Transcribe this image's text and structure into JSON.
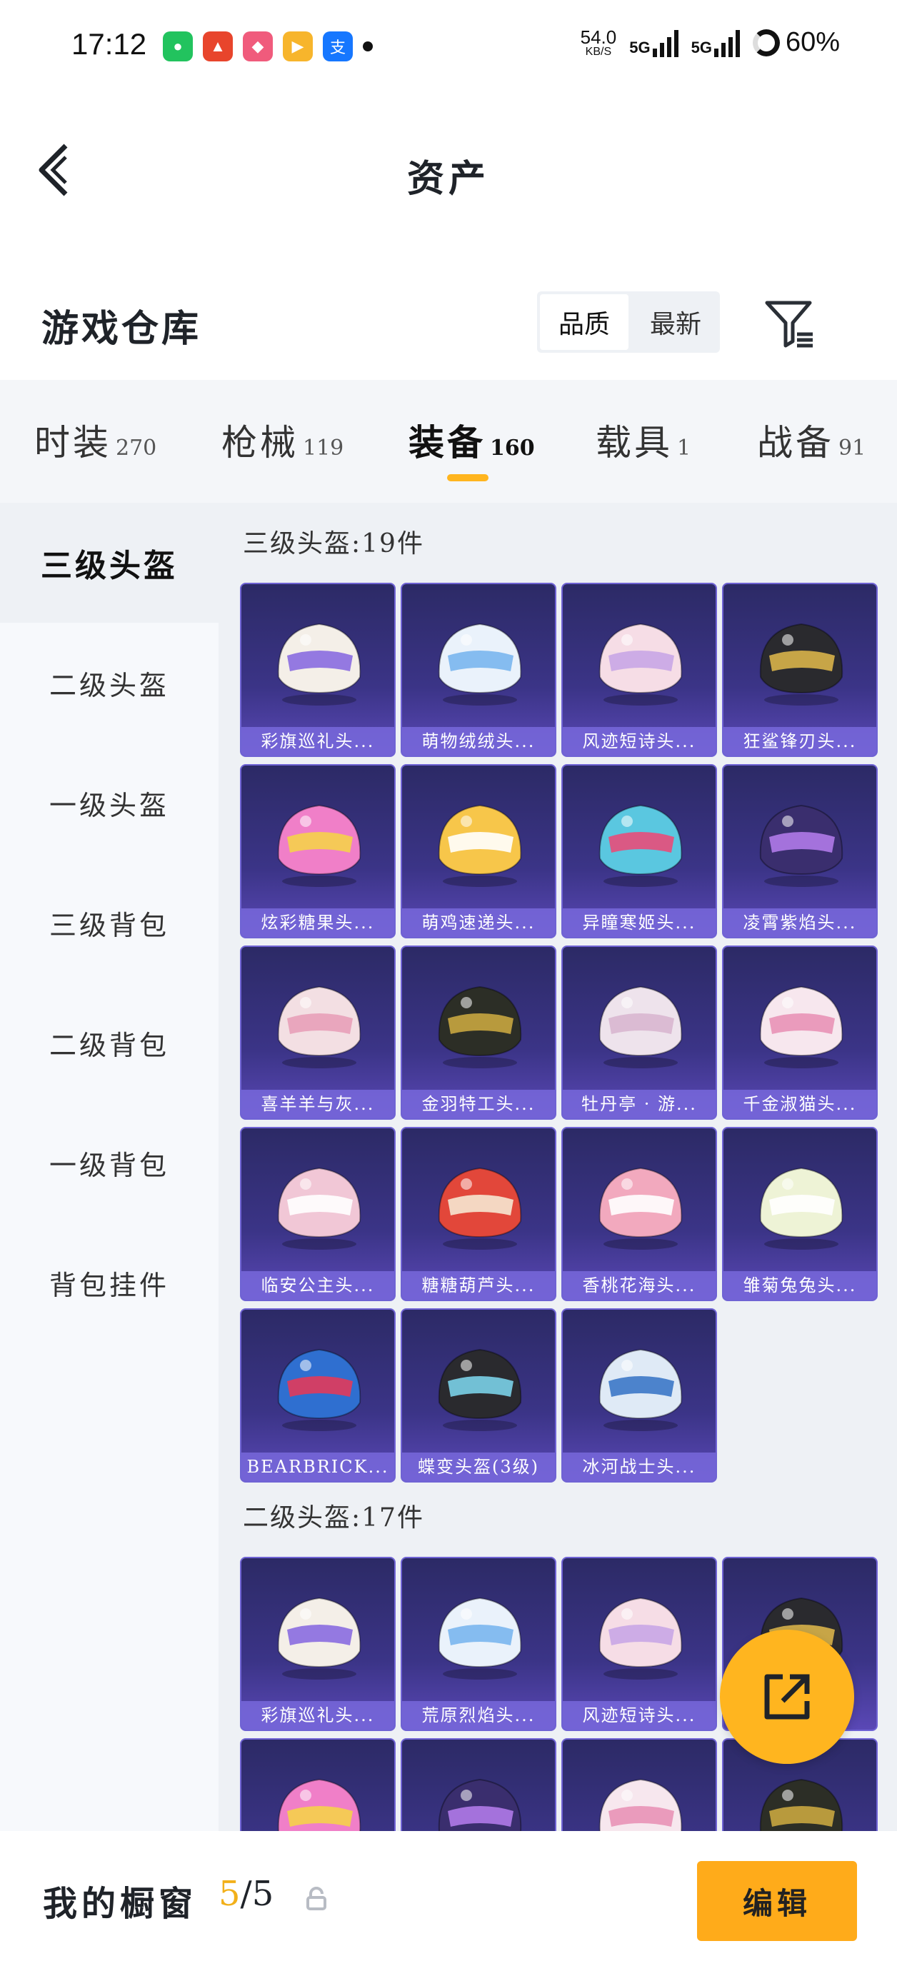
{
  "status_bar": {
    "time": "17:12",
    "speed_value": "54.0",
    "speed_unit": "KB/S",
    "signal1": "5G",
    "signal2": "5G",
    "battery": "60%"
  },
  "header": {
    "title": "资产"
  },
  "warehouse": {
    "label": "游戏仓库",
    "sort_options": [
      "品质",
      "最新"
    ],
    "sort_selected": "品质"
  },
  "tabs": [
    {
      "label": "时装",
      "count": "270"
    },
    {
      "label": "枪械",
      "count": "119"
    },
    {
      "label": "装备",
      "count": "160",
      "active": true
    },
    {
      "label": "载具",
      "count": "1"
    },
    {
      "label": "战备",
      "count": "91"
    }
  ],
  "sidebar": {
    "items": [
      "三级头盔",
      "二级头盔",
      "一级头盔",
      "三级背包",
      "二级背包",
      "一级背包",
      "背包挂件"
    ],
    "selected": "三级头盔"
  },
  "sections": [
    {
      "title": "三级头盔:19件",
      "items": [
        "彩旗巡礼头...",
        "萌物绒绒头...",
        "风迹短诗头...",
        "狂鲨锋刃头...",
        "炫彩糖果头...",
        "萌鸡速递头...",
        "异瞳寒姬头...",
        "凌霄紫焰头...",
        "喜羊羊与灰...",
        "金羽特工头...",
        "牡丹亭 · 游...",
        "千金淑猫头...",
        "临安公主头...",
        "糖糖葫芦头...",
        "香桃花海头...",
        "雏菊兔兔头...",
        "BEARBRICK...",
        "蝶变头盔(3级)",
        "冰河战士头..."
      ]
    },
    {
      "title": "二级头盔:17件",
      "items": [
        "彩旗巡礼头...",
        "荒原烈焰头...",
        "风迹短诗头...",
        ""
      ]
    }
  ],
  "showcase": {
    "label": "我的橱窗",
    "current": "5",
    "total": "/5",
    "edit_label": "编辑"
  },
  "colors": {
    "accent": "#ffb51f",
    "card_top": "#2c2a66",
    "card_bottom": "#5a48b6",
    "caption_bg": "#7868dc"
  }
}
